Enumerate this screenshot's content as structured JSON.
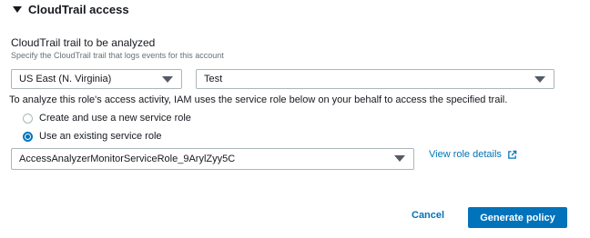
{
  "section": {
    "title": "CloudTrail access"
  },
  "trail_field": {
    "label": "CloudTrail trail to be analyzed",
    "description": "Specify the CloudTrail trail that logs events for this account",
    "region_value": "US East (N. Virginia)",
    "trail_value": "Test"
  },
  "info_text": "To analyze this role's access activity, IAM uses the service role below on your behalf to access the specified trail.",
  "radios": [
    {
      "label": "Create and use a new service role",
      "checked": false
    },
    {
      "label": "Use an existing service role",
      "checked": true
    }
  ],
  "role_select": {
    "value": "AccessAnalyzerMonitorServiceRole_9ArylZyy5C"
  },
  "view_role_link": "View role details",
  "footer": {
    "cancel_label": "Cancel",
    "generate_label": "Generate policy"
  },
  "colors": {
    "link": "#0073bb",
    "primary": "#0073bb",
    "border": "#aab7b8",
    "text": "#16191f",
    "muted": "#687078"
  },
  "icons": [
    "caret-down-icon",
    "external-link-icon",
    "radio-icon"
  ]
}
